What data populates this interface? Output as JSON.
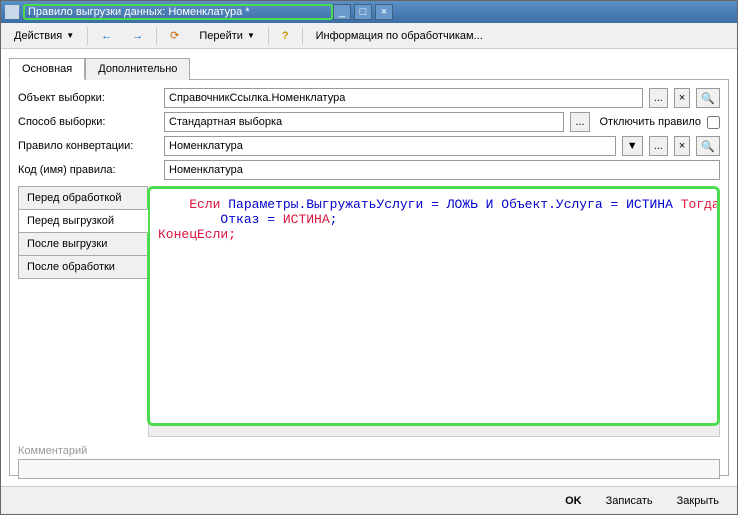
{
  "window": {
    "title": "Правило выгрузки данных: Номенклатура *"
  },
  "toolbar": {
    "actions": "Действия",
    "goto": "Перейти",
    "info": "Информация по обработчикам..."
  },
  "tabs": {
    "main": "Основная",
    "extra": "Дополнительно"
  },
  "fields": {
    "selection_object_label": "Объект выборки:",
    "selection_object_value": "СправочникСсылка.Номенклатура",
    "selection_method_label": "Способ выборки:",
    "selection_method_value": "Стандартная выборка",
    "disable_rule_label": "Отключить правило",
    "conversion_rule_label": "Правило конвертации:",
    "conversion_rule_value": "Номенклатура",
    "code_label": "Код (имя) правила:",
    "code_value": "Номенклатура"
  },
  "side_tabs": {
    "before_process": "Перед обработкой",
    "before_upload": "Перед выгрузкой",
    "after_upload": "После выгрузки",
    "after_process": "После обработки"
  },
  "code": {
    "if": "Если",
    "cond": " Параметры.ВыгружатьУслуги = ЛОЖЬ И Объект.Услуга = ИСТИНА ",
    "then": "Тогда",
    "indent": "        ",
    "deny_eq": "Отказ = ",
    "true_val": "ИСТИНА",
    "semi": ";",
    "endif": "КонецЕсли;"
  },
  "comment_label": "Комментарий",
  "bottom": {
    "ok": "OK",
    "save": "Записать",
    "close": "Закрыть"
  },
  "icons": {
    "ellipsis": "...",
    "x": "×",
    "dropdown": "▼",
    "back": "←",
    "fwd": "→",
    "help": "?",
    "min": "_",
    "max": "□"
  }
}
